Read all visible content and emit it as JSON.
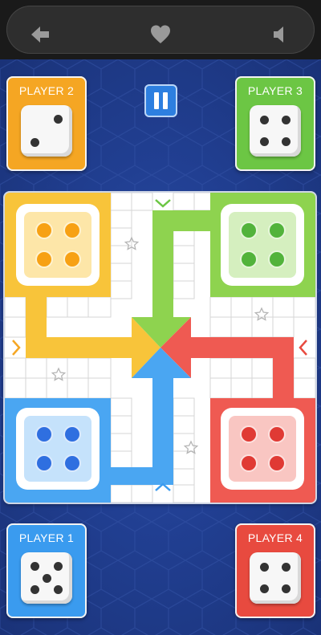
{
  "top_bar": {
    "icons": [
      "back-arrow-icon",
      "heart-icon",
      "speaker-icon"
    ]
  },
  "players": [
    {
      "id": "player-2",
      "label": "PLAYER 2",
      "color": "#f5a623",
      "dice_value": 2
    },
    {
      "id": "player-3",
      "label": "PLAYER 3",
      "color": "#6cc644",
      "dice_value": 4
    },
    {
      "id": "player-1",
      "label": "PLAYER 1",
      "color": "#3a9bef",
      "dice_value": 5
    },
    {
      "id": "player-4",
      "label": "PLAYER 4",
      "color": "#e84a3f",
      "dice_value": 4
    }
  ],
  "pause": {
    "icon": "pause-icon"
  },
  "board": {
    "colors": {
      "yellow": "#f8c43a",
      "green": "#8ed34f",
      "red": "#ef5a52",
      "blue": "#4aa6f2"
    },
    "home_tokens": {
      "yellow": 4,
      "green": 4,
      "blue": 4,
      "red": 4
    },
    "token_colors": {
      "yellow": "#f7a114",
      "green": "#52b33b",
      "blue": "#2f6fe0",
      "red": "#e03a34"
    },
    "direction_markers": [
      "chevron-down-icon",
      "chevron-right-icon",
      "chevron-left-icon",
      "chevron-up-icon"
    ],
    "safe_stars": 4
  }
}
